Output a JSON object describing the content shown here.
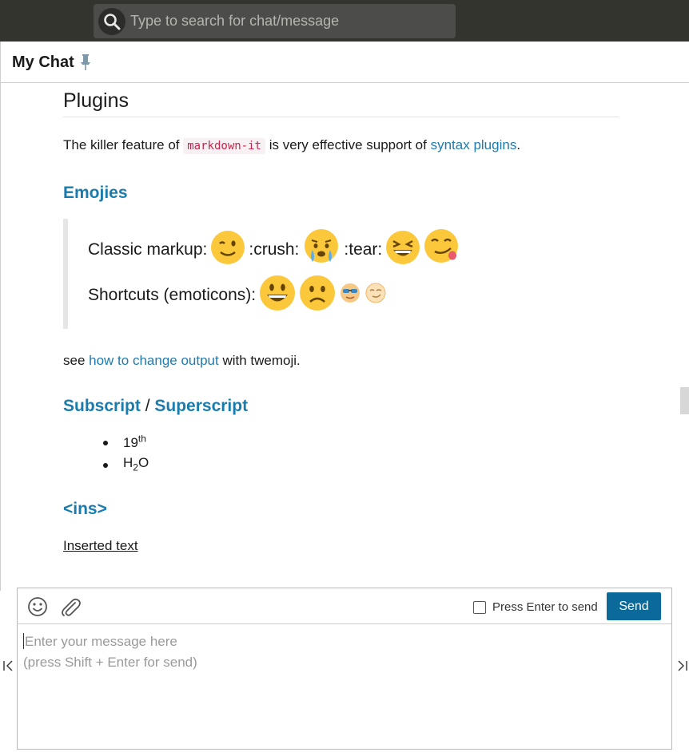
{
  "search": {
    "placeholder": "Type to search for chat/message"
  },
  "header": {
    "title": "My Chat"
  },
  "content": {
    "heading": "Plugins",
    "intro": {
      "before": "The killer feature of ",
      "code": "markdown-it",
      "middle": " is very effective support of ",
      "link": "syntax plugins",
      "after": "."
    },
    "emojies": {
      "heading": "Emojies",
      "classic_label": "Classic markup:",
      "crush": ":crush:",
      "tear": ":tear:",
      "shortcuts_label": "Shortcuts (emoticons):"
    },
    "see": {
      "before": "see ",
      "link": "how to change output",
      "after": " with twemoji."
    },
    "subsup": {
      "heading_sub": "Subscript",
      "separator": " / ",
      "heading_sup": "Superscript",
      "items": [
        {
          "base": "19",
          "sup": "th"
        },
        {
          "base1": "H",
          "sub": "2",
          "base2": "O"
        }
      ]
    },
    "ins": {
      "heading": "<ins>",
      "text": "Inserted text"
    }
  },
  "composer": {
    "enter_to_send_label": "Press Enter to send",
    "enter_to_send_checked": false,
    "send_label": "Send",
    "placeholder_line1": "Enter your message here",
    "placeholder_line2": "(press Shift + Enter for send)"
  },
  "colors": {
    "topbar": "#34342f",
    "accent": "#0c6a9a",
    "link": "#1f7aad",
    "code": "#c7254e"
  }
}
